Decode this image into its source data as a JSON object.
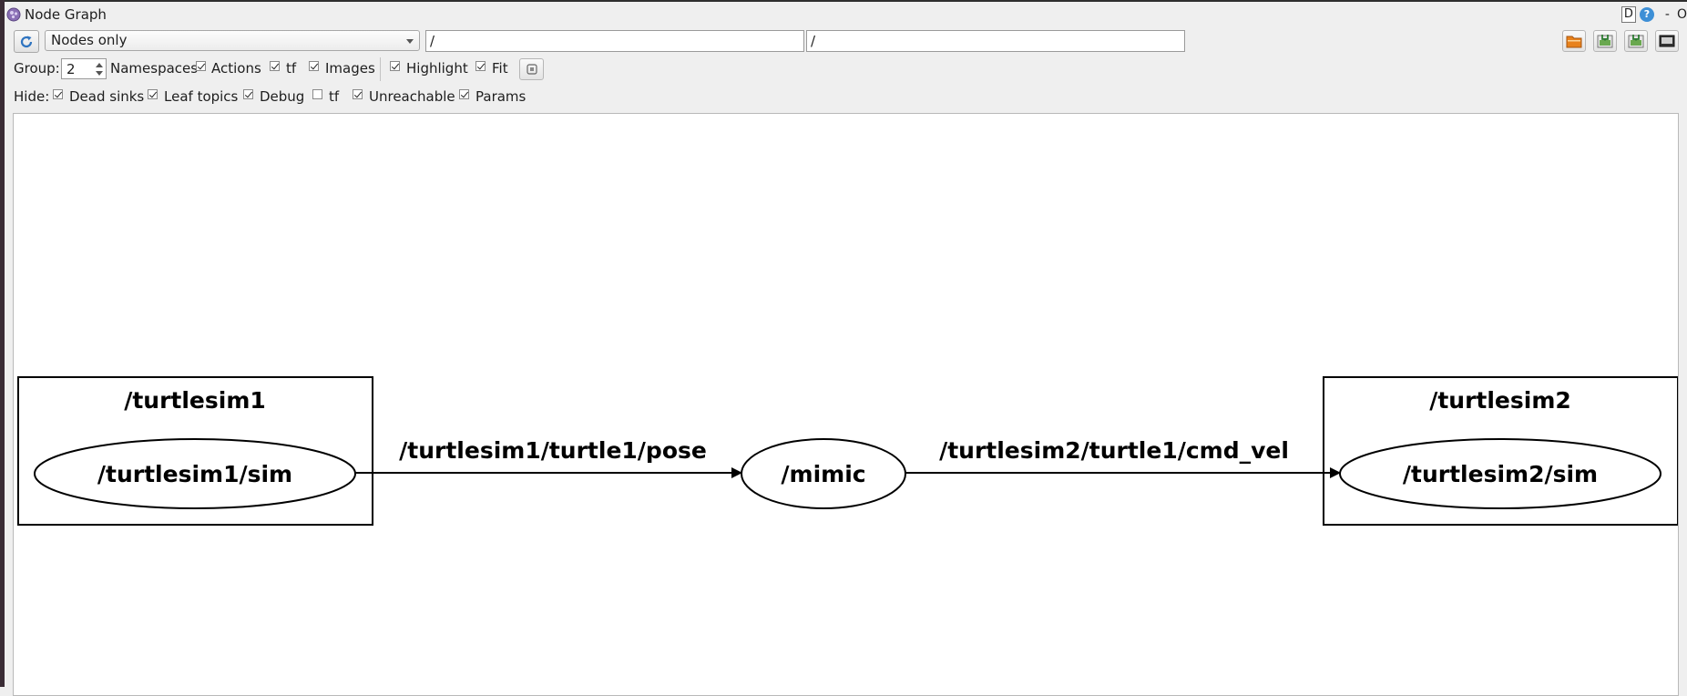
{
  "window": {
    "title": "Node Graph",
    "right_d": "D",
    "right_help": "?",
    "right_min": "-",
    "right_o": "O"
  },
  "toolbar": {
    "mode_selected": "Nodes only",
    "namespace_filter": "/",
    "exclude_filter": "/"
  },
  "options": {
    "group_label": "Group:",
    "group_value": "2",
    "namespaces_label": "Namespaces",
    "actions_label": "Actions",
    "tf_label": "tf",
    "images_label": "Images",
    "highlight_label": "Highlight",
    "fit_label": "Fit"
  },
  "hide": {
    "label": "Hide:",
    "dead_sinks": "Dead sinks",
    "leaf_topics": "Leaf topics",
    "debug": "Debug",
    "tf": "tf",
    "unreachable": "Unreachable",
    "params": "Params"
  },
  "graph": {
    "group1_label": "/turtlesim1",
    "node1": "/turtlesim1/sim",
    "edge1": "/turtlesim1/turtle1/pose",
    "node_mid": "/mimic",
    "edge2": "/turtlesim2/turtle1/cmd_vel",
    "group2_label": "/turtlesim2",
    "node2": "/turtlesim2/sim"
  }
}
